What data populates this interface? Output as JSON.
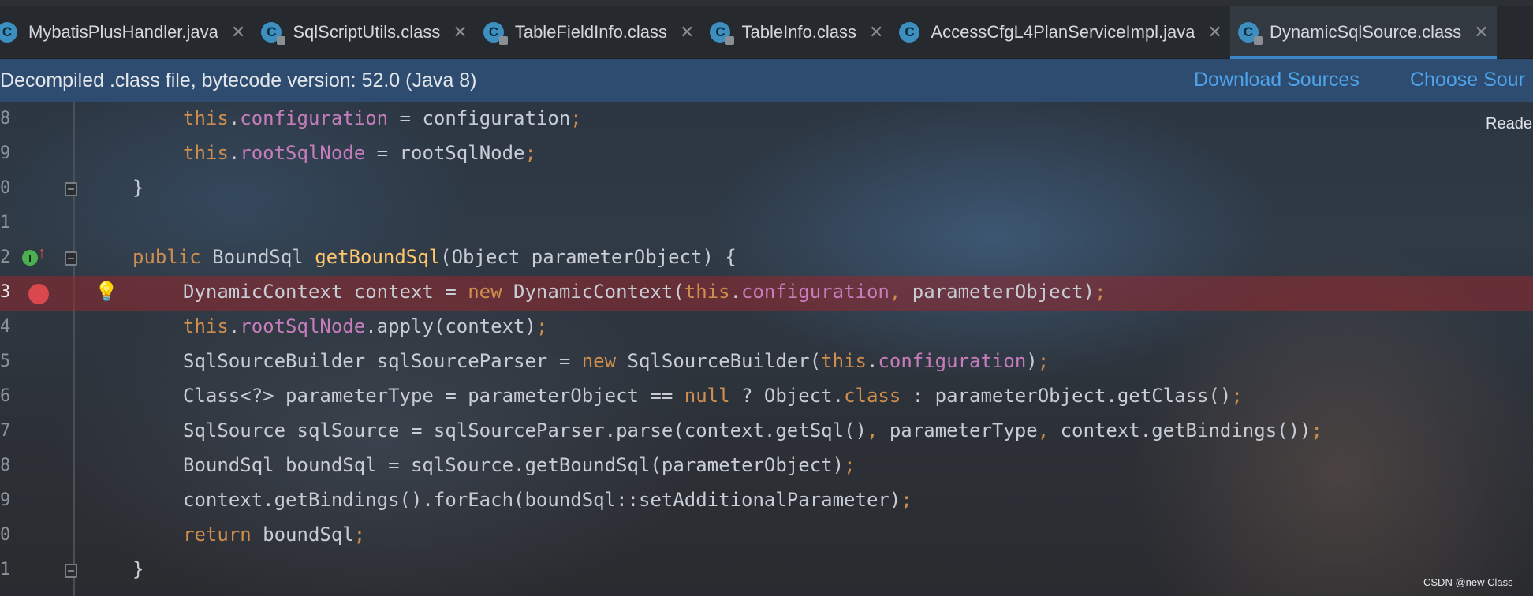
{
  "tabs": [
    {
      "label": "MybatisPlusHandler.java",
      "icon": "c",
      "active": false
    },
    {
      "label": "SqlScriptUtils.class",
      "icon": "c",
      "active": false
    },
    {
      "label": "TableFieldInfo.class",
      "icon": "c",
      "active": false
    },
    {
      "label": "TableInfo.class",
      "icon": "c",
      "active": false
    },
    {
      "label": "AccessCfgL4PlanServiceImpl.java",
      "icon": "c",
      "active": false
    },
    {
      "label": "DynamicSqlSource.class",
      "icon": "c",
      "active": true
    }
  ],
  "banner": {
    "message": "Decompiled .class file, bytecode version: 52.0 (Java 8)",
    "download_sources": "Download Sources",
    "choose_sources": "Choose Sour"
  },
  "reader_mode": "Reade",
  "code_lines": [
    {
      "num": "8",
      "indent": 2,
      "tokens": [
        [
          "kw",
          "this"
        ],
        [
          "p",
          "."
        ],
        [
          "fld",
          "configuration"
        ],
        [
          "p",
          " = configuration"
        ],
        [
          "kw",
          ";"
        ]
      ]
    },
    {
      "num": "9",
      "indent": 2,
      "tokens": [
        [
          "kw",
          "this"
        ],
        [
          "p",
          "."
        ],
        [
          "fld",
          "rootSqlNode"
        ],
        [
          "p",
          " = rootSqlNode"
        ],
        [
          "kw",
          ";"
        ]
      ]
    },
    {
      "num": "0",
      "indent": 1,
      "fold": true,
      "tokens": [
        [
          "p",
          "}"
        ]
      ]
    },
    {
      "num": "1",
      "indent": 0,
      "tokens": []
    },
    {
      "num": "2",
      "indent": 1,
      "fold": true,
      "impl": true,
      "tokens": [
        [
          "kw",
          "public "
        ],
        [
          "p",
          "BoundSql "
        ],
        [
          "fn",
          "getBoundSql"
        ],
        [
          "p",
          "(Object parameterObject) {"
        ]
      ]
    },
    {
      "num": "3",
      "indent": 2,
      "breakpoint": true,
      "bulb": true,
      "tokens": [
        [
          "p",
          "DynamicContext context = "
        ],
        [
          "kw",
          "new "
        ],
        [
          "p",
          "DynamicContext("
        ],
        [
          "kw",
          "this"
        ],
        [
          "p",
          "."
        ],
        [
          "fld",
          "configuration"
        ],
        [
          "kw",
          ", "
        ],
        [
          "p",
          "parameterObject)"
        ],
        [
          "kw",
          ";"
        ]
      ]
    },
    {
      "num": "4",
      "indent": 2,
      "tokens": [
        [
          "kw",
          "this"
        ],
        [
          "p",
          "."
        ],
        [
          "fld",
          "rootSqlNode"
        ],
        [
          "p",
          ".apply(context)"
        ],
        [
          "kw",
          ";"
        ]
      ]
    },
    {
      "num": "5",
      "indent": 2,
      "tokens": [
        [
          "p",
          "SqlSourceBuilder sqlSourceParser = "
        ],
        [
          "kw",
          "new "
        ],
        [
          "p",
          "SqlSourceBuilder("
        ],
        [
          "kw",
          "this"
        ],
        [
          "p",
          "."
        ],
        [
          "fld",
          "configuration"
        ],
        [
          "p",
          ")"
        ],
        [
          "kw",
          ";"
        ]
      ]
    },
    {
      "num": "6",
      "indent": 2,
      "tokens": [
        [
          "p",
          "Class<?> parameterType = parameterObject == "
        ],
        [
          "kw",
          "null"
        ],
        [
          "p",
          " ? Object."
        ],
        [
          "kw",
          "class"
        ],
        [
          "p",
          " : parameterObject.getClass()"
        ],
        [
          "kw",
          ";"
        ]
      ]
    },
    {
      "num": "7",
      "indent": 2,
      "tokens": [
        [
          "p",
          "SqlSource sqlSource = sqlSourceParser.parse(context.getSql()"
        ],
        [
          "kw",
          ", "
        ],
        [
          "p",
          "parameterType"
        ],
        [
          "kw",
          ", "
        ],
        [
          "p",
          "context.getBindings())"
        ],
        [
          "kw",
          ";"
        ]
      ]
    },
    {
      "num": "8",
      "indent": 2,
      "tokens": [
        [
          "p",
          "BoundSql boundSql = sqlSource.getBoundSql(parameterObject)"
        ],
        [
          "kw",
          ";"
        ]
      ]
    },
    {
      "num": "9",
      "indent": 2,
      "tokens": [
        [
          "p",
          "context.getBindings().forEach(boundSql::setAdditionalParameter)"
        ],
        [
          "kw",
          ";"
        ]
      ]
    },
    {
      "num": "0",
      "indent": 2,
      "tokens": [
        [
          "kw",
          "return "
        ],
        [
          "p",
          "boundSql"
        ],
        [
          "kw",
          ";"
        ]
      ]
    },
    {
      "num": "1",
      "indent": 1,
      "fold": true,
      "tokens": [
        [
          "p",
          "}"
        ]
      ]
    }
  ],
  "watermark": "CSDN @new Class",
  "colors": {
    "accent": "#3d86c6",
    "breakpoint": "#d9484d",
    "keyword": "#cf8e4e",
    "field": "#c77dbb",
    "method": "#ffc66d"
  }
}
